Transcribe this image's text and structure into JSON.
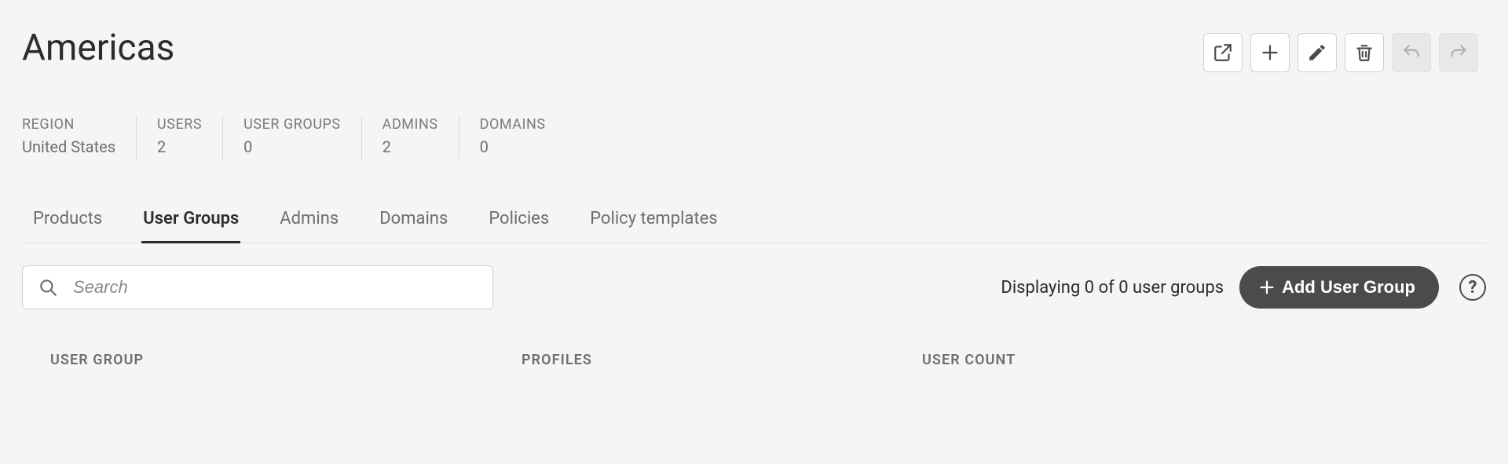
{
  "title": "Americas",
  "stats": [
    {
      "label": "REGION",
      "value": "United States"
    },
    {
      "label": "USERS",
      "value": "2"
    },
    {
      "label": "USER GROUPS",
      "value": "0"
    },
    {
      "label": "ADMINS",
      "value": "2"
    },
    {
      "label": "DOMAINS",
      "value": "0"
    }
  ],
  "tabs": [
    {
      "label": "Products",
      "active": false
    },
    {
      "label": "User Groups",
      "active": true
    },
    {
      "label": "Admins",
      "active": false
    },
    {
      "label": "Domains",
      "active": false
    },
    {
      "label": "Policies",
      "active": false
    },
    {
      "label": "Policy templates",
      "active": false
    }
  ],
  "search": {
    "placeholder": "Search",
    "value": ""
  },
  "count_text": "Displaying 0 of 0 user groups",
  "add_button_label": "Add User Group",
  "help_glyph": "?",
  "table": {
    "columns": [
      "USER GROUP",
      "PROFILES",
      "USER COUNT"
    ]
  },
  "toolbar_icons": {
    "export": "export-icon",
    "add": "plus-icon",
    "edit": "pencil-icon",
    "delete": "trash-icon",
    "undo": "undo-icon",
    "redo": "redo-icon"
  }
}
